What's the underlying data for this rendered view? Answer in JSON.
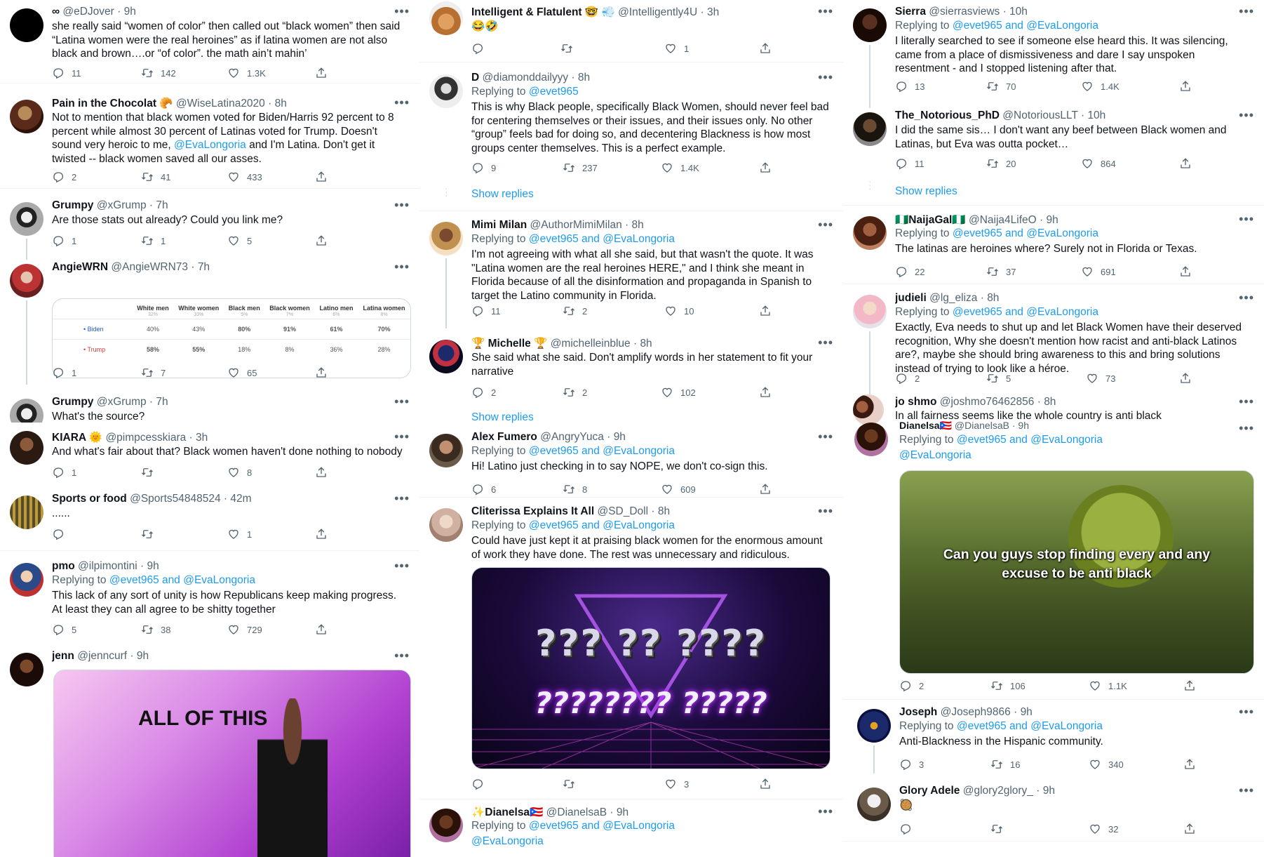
{
  "columns": [
    {
      "tweets": [
        {
          "name": "∞",
          "handle": "@eDJover",
          "time": "9h",
          "body": "she really said “women of color” then called out “black women” then said “Latina women were the real heroines” as if latina women are not also black and brown….or “of color”. the math ain’t mahin’",
          "replies": "11",
          "retweets": "142",
          "likes": "1.3K"
        },
        {
          "name": "Pain in the Chocolat 🥐",
          "handle": "@WiseLatina2020",
          "time": "8h",
          "body_a": "Not to mention that black women voted for Biden/Harris 92 percent to 8 percent while almost 30 percent of Latinas voted for Trump. Doesn't sound very heroic to me, ",
          "mention": "@EvaLongoria",
          "body_b": " and I'm Latina. Don't get it twisted -- black women saved all our asses.",
          "replies": "2",
          "retweets": "41",
          "likes": "433"
        },
        {
          "name": "Grumpy",
          "handle": "@xGrump",
          "time": "7h",
          "body": "Are those stats out already? Could you link me?",
          "replies": "1",
          "retweets": "1",
          "likes": "5"
        },
        {
          "name": "AngieWRN",
          "handle": "@AngieWRN73",
          "time": "7h",
          "replies": "1",
          "retweets": "7",
          "likes": "65",
          "table": {
            "headers": [
              {
                "h": "White men",
                "s": "32%"
              },
              {
                "h": "White women",
                "s": "33%"
              },
              {
                "h": "Black men",
                "s": "5%"
              },
              {
                "h": "Black women",
                "s": "7%"
              },
              {
                "h": "Latino men",
                "s": "6%"
              },
              {
                "h": "Latina women",
                "s": "8%"
              }
            ],
            "rows": [
              {
                "label": "• Biden",
                "values": [
                  "40%",
                  "43%",
                  "80%",
                  "91%",
                  "61%",
                  "70%"
                ]
              },
              {
                "label": "• Trump",
                "values": [
                  "58%",
                  "55%",
                  "18%",
                  "8%",
                  "36%",
                  "28%"
                ]
              }
            ]
          }
        },
        {
          "name": "Grumpy",
          "handle": "@xGrump",
          "time": "7h",
          "body": "What's the source?"
        },
        {
          "name": "KIARA 🌞",
          "handle": "@pimpcesskiara",
          "time": "3h",
          "body": "And what's fair about that? Black women haven't done nothing to nobody",
          "replies": "1",
          "retweets": "",
          "likes": "8"
        },
        {
          "name": "Sports or food",
          "handle": "@Sports54848524",
          "time": "42m",
          "body": "......",
          "replies": "",
          "retweets": "",
          "likes": "1"
        },
        {
          "name": "pmo",
          "handle": "@ilpimontini",
          "time": "9h",
          "replying": "Replying to",
          "reply_to": "@evet965 and @EvaLongoria",
          "body": "This lack of any sort of unity is how Republicans keep making progress. At least they can all agree to be shitty together",
          "replies": "5",
          "retweets": "38",
          "likes": "729"
        },
        {
          "name": "jenn",
          "handle": "@jenncurf",
          "time": "9h",
          "gif_caption": "ALL OF THIS"
        }
      ]
    },
    {
      "tweets": [
        {
          "name": "Intelligent & Flatulent 🤓 💨",
          "handle": "@Intelligently4U",
          "time": "3h",
          "body": "😂🤣",
          "replies": "",
          "retweets": "",
          "likes": "1"
        },
        {
          "name": "D",
          "handle": "@diamonddailyyy",
          "time": "8h",
          "replying": "Replying to",
          "reply_to": "@evet965",
          "body": "This is why Black people, specifically Black Women, should never feel bad for centering themselves or their issues, and their issues only. No other “group” feels bad for doing so, and decentering Blackness is how most groups center themselves. This is a perfect example.",
          "replies": "9",
          "retweets": "237",
          "likes": "1.4K",
          "show_replies": "Show replies"
        },
        {
          "name": "Mimi Milan",
          "handle": "@AuthorMimiMilan",
          "time": "8h",
          "replying": "Replying to",
          "reply_to": "@evet965 and @EvaLongoria",
          "body": "I'm not agreeing with what all she said, but that wasn't the quote. It was \"Latina women are the real heroines HERE,\" and I think she meant in Florida because of all the disinformation and propaganda in Spanish to target the Latino community in Florida.",
          "replies": "11",
          "retweets": "2",
          "likes": "10"
        },
        {
          "name": "🏆 Michelle 🏆",
          "handle": "@michelleinblue",
          "time": "8h",
          "body": "She said what she said.  Don't amplify words in her statement to fit your narrative",
          "replies": "2",
          "retweets": "2",
          "likes": "102",
          "show_replies": "Show replies"
        },
        {
          "name": "Alex Fumero",
          "handle": "@AngryYuca",
          "time": "9h",
          "replying": "Replying to",
          "reply_to": "@evet965 and @EvaLongoria",
          "body": "Hi!  Latino just checking in to say NOPE, we don't co-sign this.",
          "replies": "6",
          "retweets": "8",
          "likes": "609"
        },
        {
          "name": "Cliterissa Explains It All",
          "handle": "@SD_Doll",
          "time": "8h",
          "replying": "Replying to",
          "reply_to": "@evet965 and @EvaLongoria",
          "body": "Could have just kept it at praising black women for the enormous amount of work they have done. The rest was unnecessary and ridiculous.",
          "replies": "",
          "retweets": "",
          "likes": "3",
          "img_line1": "??? ?? ????",
          "img_line2": "???????? ?????"
        },
        {
          "name": "✨Dianelsa🇵🇷",
          "handle": "@DianelsaB",
          "time": "9h",
          "replying": "Replying to",
          "reply_to": "@evet965 and @EvaLongoria",
          "reply_to2": "@EvaLongoria"
        }
      ]
    },
    {
      "tweets": [
        {
          "name": "Sierra",
          "handle": "@sierrasviews",
          "time": "10h",
          "replying": "Replying to",
          "reply_to": "@evet965 and @EvaLongoria",
          "body": "I literally searched to see if someone else heard this. It was silencing, came from a place of dismissiveness and dare I say unspoken resentment - and I stopped listening after that.",
          "replies": "13",
          "retweets": "70",
          "likes": "1.4K"
        },
        {
          "name": "The_Notorious_PhD",
          "handle": "@NotoriousLLT",
          "time": "10h",
          "body": "I did the same sis… I don't want any beef between Black women and Latinas, but Eva was outta pocket…",
          "replies": "11",
          "retweets": "20",
          "likes": "864",
          "show_replies": "Show replies"
        },
        {
          "name": "🇳🇬NaijaGal🇳🇬",
          "handle": "@Naija4LifeO",
          "time": "9h",
          "replying": "Replying to",
          "reply_to": "@evet965 and @EvaLongoria",
          "body": "The latinas are heroines where? Surely not in Florida or Texas.",
          "replies": "22",
          "retweets": "37",
          "likes": "691"
        },
        {
          "name": "judieli",
          "handle": "@lg_eliza",
          "time": "8h",
          "replying": "Replying to",
          "reply_to": "@evet965 and @EvaLongoria",
          "body": "Exactly, Eva needs to shut up and let Black Women have their deserved recognition, Why she doesn't mention how racist and anti-black Latinos are?, maybe she should bring awareness to this and bring solutions instead of trying to look like a héroe.",
          "replies": "2",
          "retweets": "5",
          "likes": "73"
        },
        {
          "name": "jo shmo",
          "handle": "@joshmo76462856",
          "time": "8h",
          "body": "In all fairness seems like the whole country is anti black"
        },
        {
          "name": "Dianelsa🇵🇷",
          "handle": "@DianelsaB",
          "time": "9h",
          "replying": "Replying to",
          "reply_to": "@evet965 and @EvaLongoria",
          "reply_to2": "@EvaLongoria",
          "caption": "Can you guys stop finding every and any excuse to be anti black",
          "replies": "2",
          "retweets": "106",
          "likes": "1.1K"
        },
        {
          "name": "Joseph",
          "handle": "@Joseph9866",
          "time": "9h",
          "replying": "Replying to",
          "reply_to": "@evet965 and @EvaLongoria",
          "body": "Anti-Blackness in the Hispanic community.",
          "replies": "3",
          "retweets": "16",
          "likes": "340"
        },
        {
          "name": "Glory Adele",
          "handle": "@glory2glory_",
          "time": "9h",
          "body": "🥘",
          "replies": "",
          "retweets": "",
          "likes": "32"
        }
      ]
    }
  ]
}
